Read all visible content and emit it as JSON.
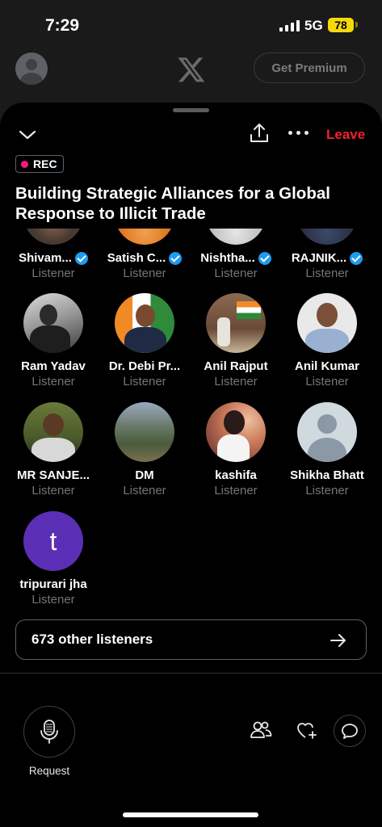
{
  "status_bar": {
    "time": "7:29",
    "network": "5G",
    "battery": "78"
  },
  "background_header": {
    "premium_label": "Get Premium"
  },
  "space": {
    "leave_label": "Leave",
    "rec_label": "REC",
    "title": "Building Strategic Alliances for a Global Response to Illicit Trade"
  },
  "participants": [
    {
      "name": "Shivam...",
      "role": "Listener",
      "verified": true
    },
    {
      "name": "Satish C...",
      "role": "Listener",
      "verified": true
    },
    {
      "name": "Nishtha...",
      "role": "Listener",
      "verified": true
    },
    {
      "name": "RAJNIK...",
      "role": "Listener",
      "verified": true
    },
    {
      "name": "Ram Yadav",
      "role": "Listener",
      "verified": false
    },
    {
      "name": "Dr. Debi Pr...",
      "role": "Listener",
      "verified": false
    },
    {
      "name": "Anil Rajput",
      "role": "Listener",
      "verified": false
    },
    {
      "name": "Anil Kumar",
      "role": "Listener",
      "verified": false
    },
    {
      "name": "MR SANJE...",
      "role": "Listener",
      "verified": false
    },
    {
      "name": "DM",
      "role": "Listener",
      "verified": false
    },
    {
      "name": "kashifa",
      "role": "Listener",
      "verified": false
    },
    {
      "name": "Shikha Bhatt",
      "role": "Listener",
      "verified": false
    },
    {
      "name": "tripurari jha",
      "role": "Listener",
      "verified": false,
      "initial": "t"
    }
  ],
  "other_listeners": "673 other listeners",
  "bottom_bar": {
    "request_label": "Request"
  },
  "colors": {
    "leave": "#f4212e",
    "rec_dot": "#f91880",
    "verified": "#1d9bf0",
    "initial_avatar": "#5b2fb5"
  }
}
